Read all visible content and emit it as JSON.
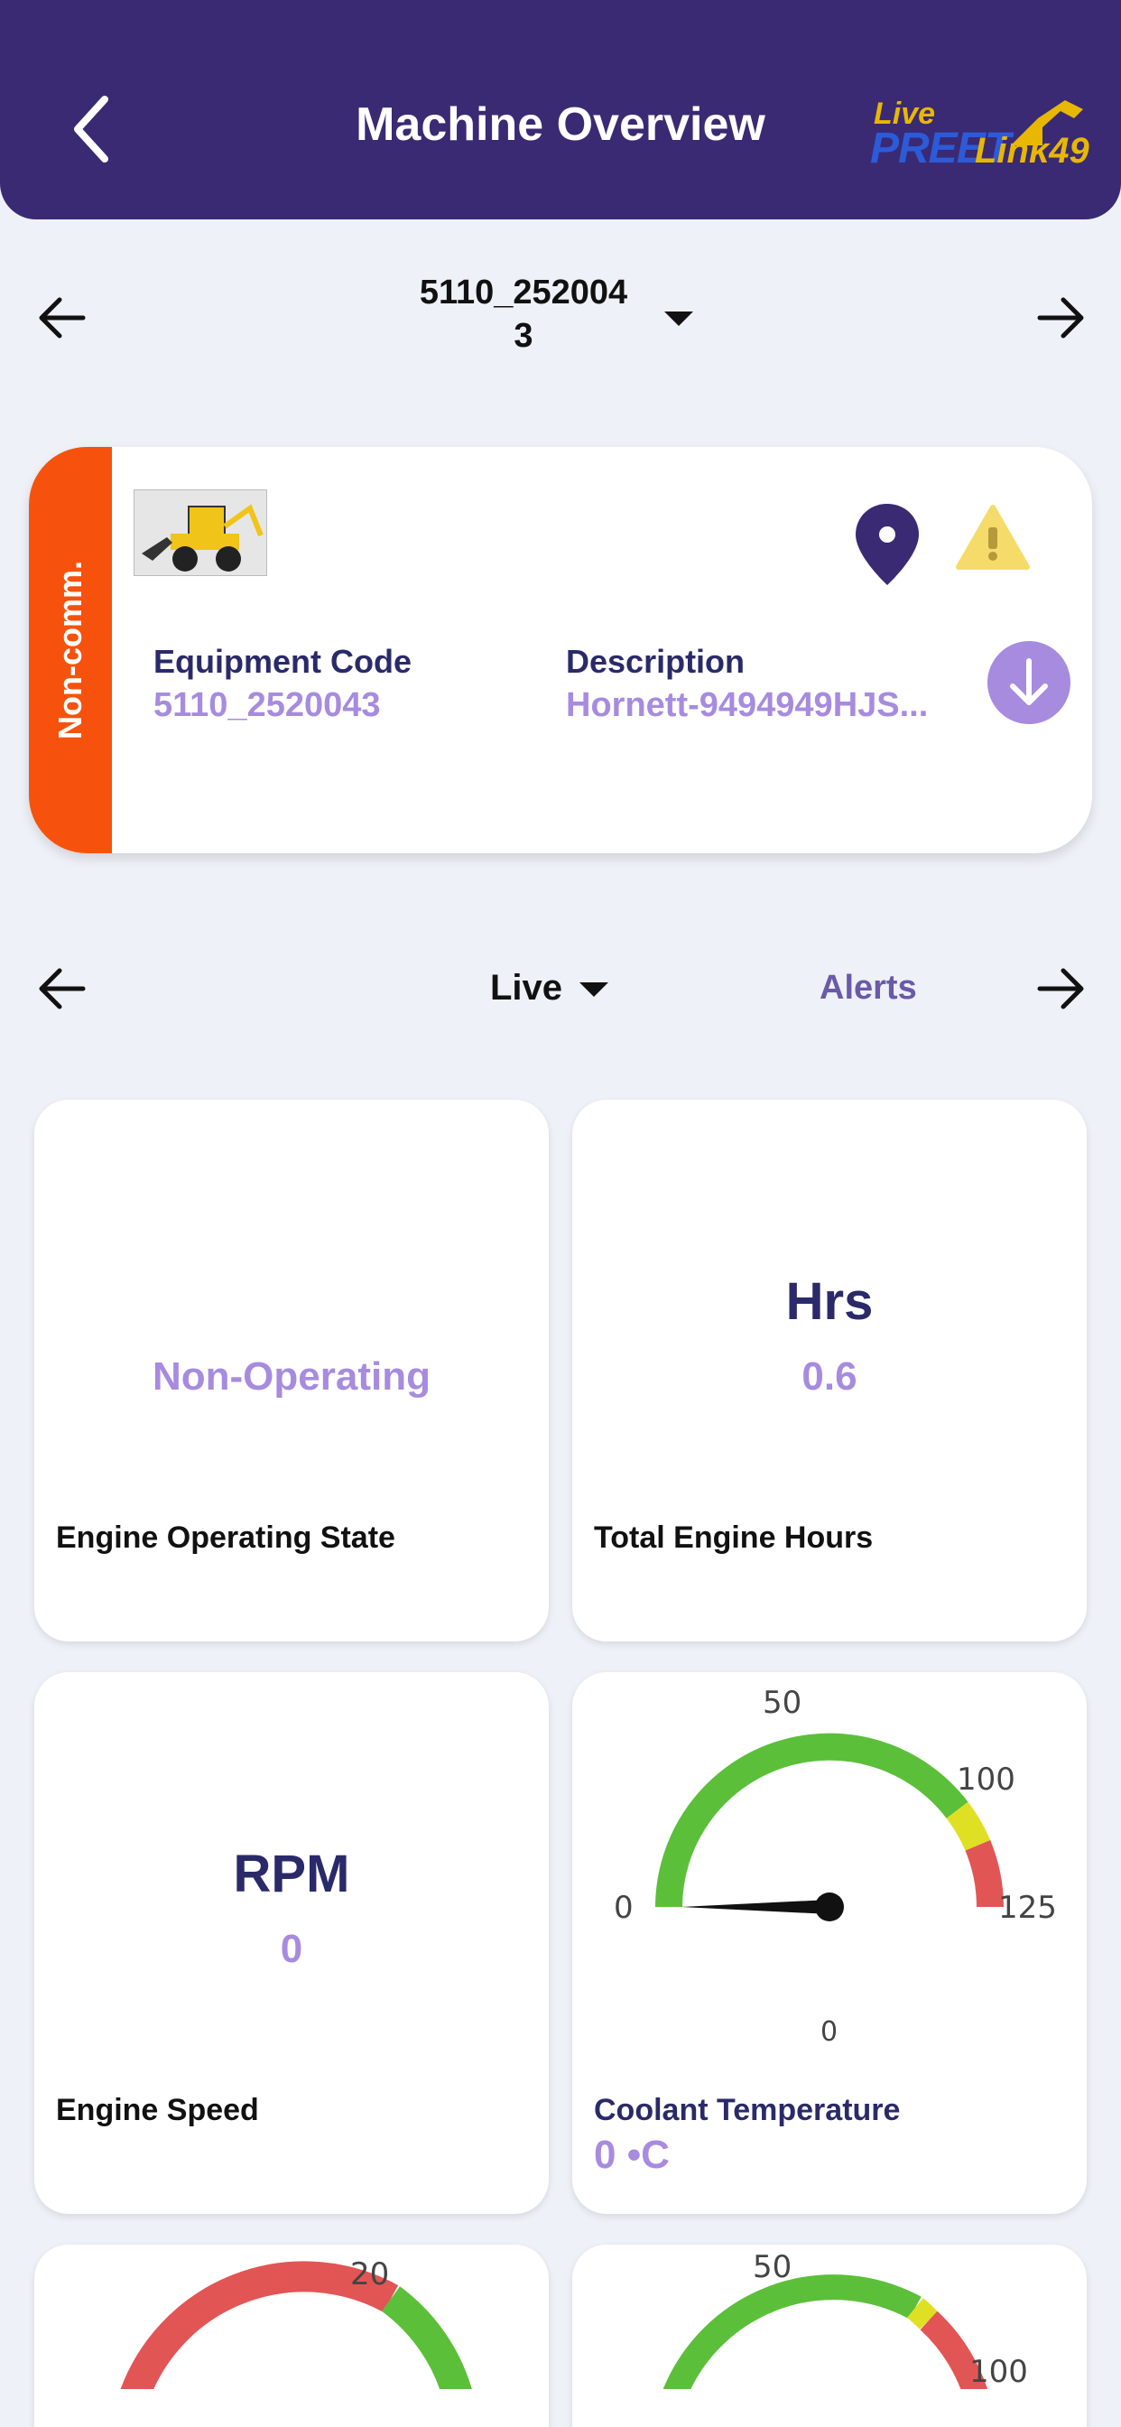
{
  "header": {
    "title": "Machine Overview",
    "logo": {
      "line1": "Live",
      "line2": "PREET",
      "line3": "Link49"
    }
  },
  "machine_selector": {
    "id_line1": "5110_252004",
    "id_line2": "3"
  },
  "machine_card": {
    "status": "Non-comm.",
    "equipment_code_label": "Equipment Code",
    "equipment_code_value": "5110_2520043",
    "description_label": "Description",
    "description_value": "Hornett-9494949HJS..."
  },
  "tabs": {
    "live_label": "Live",
    "alerts_label": "Alerts"
  },
  "tiles": {
    "engine_state": {
      "value": "Non-Operating",
      "label": "Engine Operating State"
    },
    "engine_hours": {
      "unit": "Hrs",
      "value": "0.6",
      "label": "Total Engine Hours"
    },
    "engine_speed": {
      "unit": "RPM",
      "value": "0",
      "label": "Engine Speed"
    },
    "coolant": {
      "label": "Coolant Temperature",
      "value_text": "0 •C",
      "gauge": {
        "min_label": "0",
        "tick_50": "50",
        "tick_100": "100",
        "max_label": "125",
        "readout": "0",
        "value": 0
      }
    },
    "bottom_left_gauge": {
      "tick": "20"
    },
    "bottom_right_gauge": {
      "tick_50": "50",
      "tick_100": "100"
    }
  },
  "colors": {
    "header": "#3a2a73",
    "accent": "#a78bdf",
    "status_noncomm": "#f6520e",
    "gauge_green": "#5bbf3a",
    "gauge_yellow": "#dfe024",
    "gauge_red": "#e25555"
  }
}
